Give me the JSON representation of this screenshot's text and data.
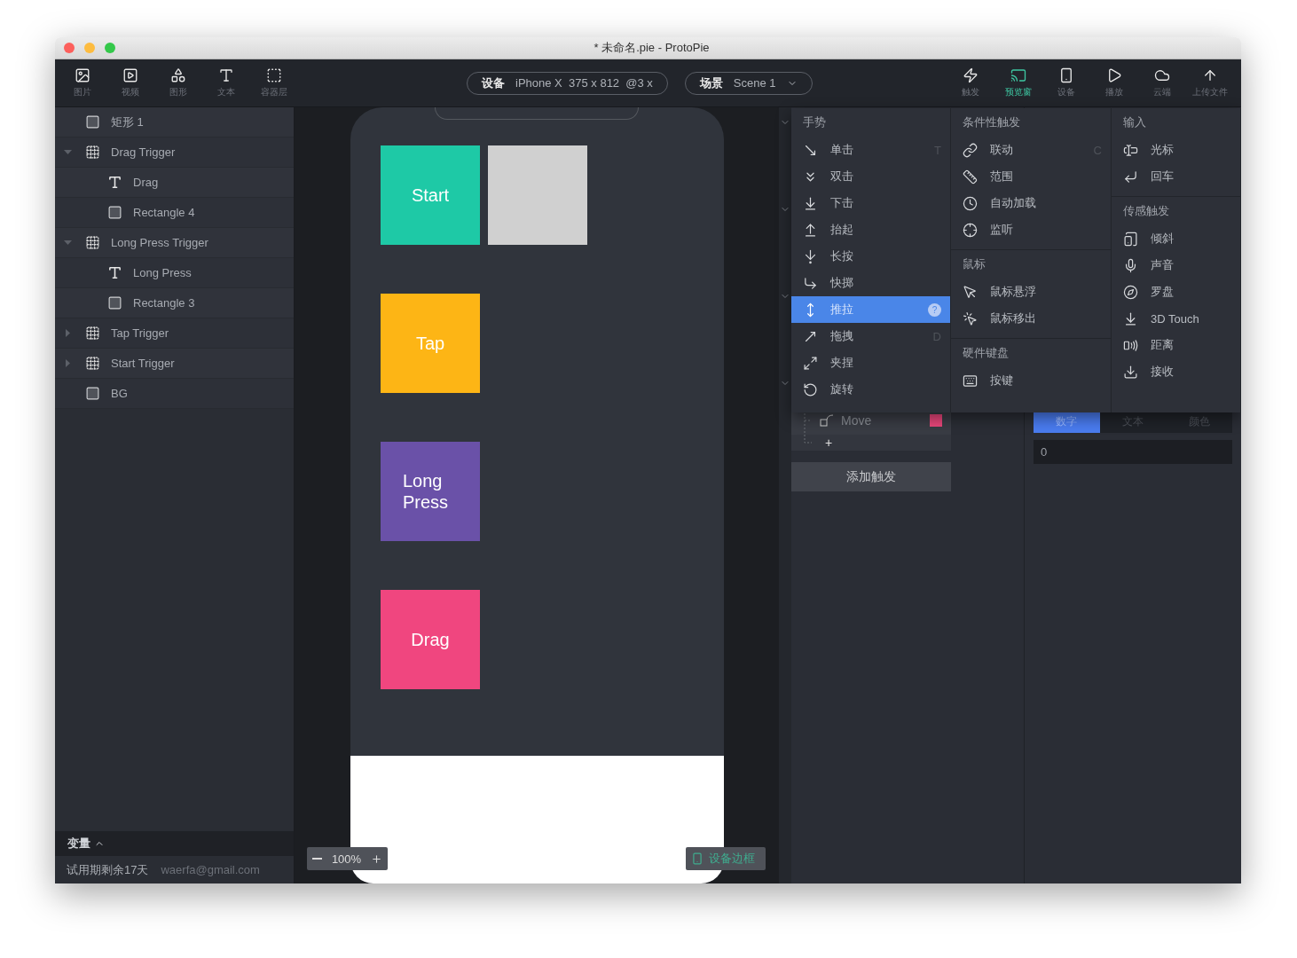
{
  "window": {
    "title": "* 未命名.pie - ProtoPie"
  },
  "toolbar": {
    "tools": [
      {
        "label": "图片"
      },
      {
        "label": "视频"
      },
      {
        "label": "图形"
      },
      {
        "label": "文本"
      },
      {
        "label": "容器层"
      }
    ],
    "device_pill": {
      "label": "设备",
      "value": "iPhone X  375 x 812  @3 x"
    },
    "scene_pill": {
      "label": "场景",
      "value": "Scene 1"
    },
    "right_tools": [
      {
        "label": "触发",
        "selected": false
      },
      {
        "label": "预览窗",
        "selected": true
      },
      {
        "label": "设备",
        "selected": false
      },
      {
        "label": "播放",
        "selected": false
      },
      {
        "label": "云端",
        "selected": false
      },
      {
        "label": "上传文件",
        "selected": false
      }
    ]
  },
  "layers": [
    {
      "name": "矩形 1",
      "kind": "rect"
    },
    {
      "name": "Drag Trigger",
      "kind": "group",
      "expanded": true,
      "children": [
        {
          "name": "Drag",
          "kind": "text"
        },
        {
          "name": "Rectangle 4",
          "kind": "rect"
        }
      ]
    },
    {
      "name": "Long Press Trigger",
      "kind": "group",
      "expanded": true,
      "children": [
        {
          "name": "Long Press",
          "kind": "text"
        },
        {
          "name": "Rectangle 3",
          "kind": "rect"
        }
      ]
    },
    {
      "name": "Tap Trigger",
      "kind": "group",
      "expanded": false
    },
    {
      "name": "Start Trigger",
      "kind": "group",
      "expanded": false
    },
    {
      "name": "BG",
      "kind": "rect"
    }
  ],
  "variables": {
    "label": "变量",
    "expanded": true
  },
  "footer": {
    "trial": "试用期剩余17天",
    "email": "waerfa@gmail.com"
  },
  "canvas": {
    "rows": [
      {
        "cards": [
          {
            "label": "Start",
            "color": "#1ec9a6"
          },
          {
            "color": "#d0d0d0"
          }
        ]
      },
      {
        "cards": [
          {
            "label": "Tap",
            "color": "#fdb515"
          }
        ]
      },
      {
        "cards": [
          {
            "label": "Long Press",
            "color": "#6a51a8"
          }
        ]
      },
      {
        "cards": [
          {
            "label": "Drag",
            "color": "#f0467f"
          }
        ]
      }
    ],
    "zoom": "100%",
    "device_frame_button": "设备边框"
  },
  "trigger_menu": {
    "columns": [
      {
        "sections": [
          {
            "title": "手势",
            "items": [
              {
                "label": "单击",
                "shortcut": "T",
                "selected": false
              },
              {
                "label": "双击",
                "selected": false
              },
              {
                "label": "下击",
                "selected": false
              },
              {
                "label": "抬起",
                "selected": false
              },
              {
                "label": "长按",
                "selected": false
              },
              {
                "label": "快掷",
                "selected": false
              },
              {
                "label": "推拉",
                "selected": true,
                "badge": "?"
              },
              {
                "label": "拖拽",
                "shortcut": "D",
                "selected": false
              },
              {
                "label": "夹捏",
                "selected": false
              },
              {
                "label": "旋转",
                "selected": false
              }
            ]
          }
        ]
      },
      {
        "sections": [
          {
            "title": "条件性触发",
            "items": [
              {
                "label": "联动",
                "shortcut": "C",
                "selected": false
              },
              {
                "label": "范围",
                "selected": false
              },
              {
                "label": "自动加载",
                "selected": false
              },
              {
                "label": "监听",
                "selected": false
              }
            ]
          },
          {
            "title": "鼠标",
            "items": [
              {
                "label": "鼠标悬浮",
                "selected": false
              },
              {
                "label": "鼠标移出",
                "selected": false
              }
            ]
          },
          {
            "title": "硬件键盘",
            "items": [
              {
                "label": "按键",
                "selected": false
              }
            ]
          }
        ]
      },
      {
        "sections": [
          {
            "title": "输入",
            "items": [
              {
                "label": "光标",
                "selected": false
              },
              {
                "label": "回车",
                "selected": false
              }
            ]
          },
          {
            "title": "传感触发",
            "items": [
              {
                "label": "倾斜",
                "selected": false
              },
              {
                "label": "声音",
                "selected": false
              },
              {
                "label": "罗盘",
                "selected": false
              },
              {
                "label": "3D Touch",
                "selected": false
              },
              {
                "label": "距离",
                "selected": false
              },
              {
                "label": "接收",
                "selected": false
              }
            ]
          }
        ]
      }
    ]
  },
  "triggers": {
    "responses": [
      {
        "label": "Move",
        "color": "#e8467a"
      }
    ],
    "add_response": "+",
    "add_trigger_button": "添加触发"
  },
  "property": {
    "tabs": [
      {
        "label": "数字",
        "selected": true
      },
      {
        "label": "文本",
        "selected": false
      },
      {
        "label": "颜色",
        "selected": false
      }
    ],
    "value": "0"
  }
}
